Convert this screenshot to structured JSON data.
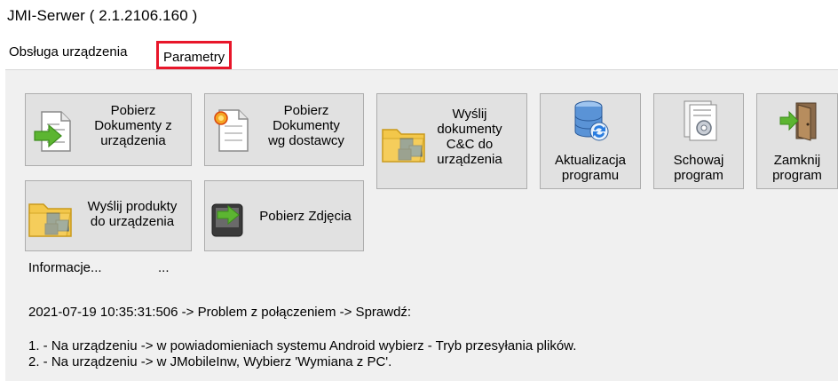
{
  "window": {
    "title": "JMI-Serwer ( 2.1.2106.160 )"
  },
  "tabs": [
    {
      "label": "Obsługa urządzenia"
    },
    {
      "label": "Parametry"
    }
  ],
  "buttons": {
    "pobierz_dokumenty": "Pobierz\nDokumenty z\nurządzenia",
    "pobierz_dostawcy": "Pobierz\nDokumenty\nwg dostawcy",
    "wyslij_dokumenty": "Wyślij\ndokumenty\nC&C do\nurządzenia",
    "aktualizacja": "Aktualizacja\nprogramu",
    "schowaj": "Schowaj\nprogram",
    "zamknij": "Zamknij\nprogram",
    "wyslij_produkty": "Wyślij produkty\ndo urządzenia",
    "pobierz_zdjecia": "Pobierz Zdjęcia"
  },
  "icons": {
    "pobierz_dokumenty": "document-arrow-in-icon",
    "pobierz_dostawcy": "document-sun-icon",
    "wyslij_dokumenty": "folder-boxes-icon",
    "aktualizacja": "database-sync-icon",
    "schowaj": "document-gear-icon",
    "zamknij": "door-exit-icon",
    "wyslij_produkty": "folder-boxes-icon",
    "pobierz_zdjecia": "device-arrow-icon"
  },
  "info": {
    "label": "Informacje...",
    "dots": "...",
    "line1": "2021-07-19 10:35:31:506 -> Problem z połączeniem -> Sprawdź:",
    "line2": "1. - Na urządzeniu -> w powiadomieniach systemu Android wybierz - Tryb przesyłania plików.",
    "line3": "2. - Na urządzeniu -> w JMobileInw, Wybierz 'Wymiana z PC'."
  },
  "colors": {
    "highlight": "#e8162a",
    "button_bg": "#e1e1e1",
    "panel_bg": "#f0f0f0"
  }
}
